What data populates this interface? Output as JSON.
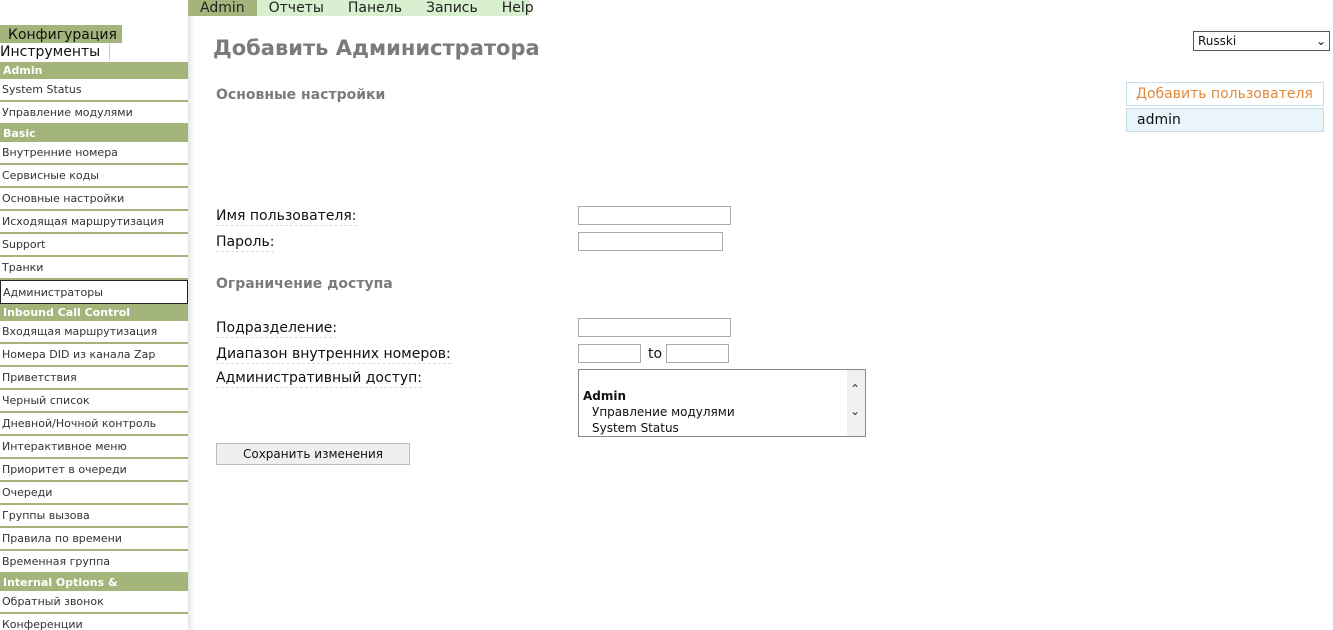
{
  "topmenu": {
    "items": [
      {
        "label": "Admin"
      },
      {
        "label": "Отчеты"
      },
      {
        "label": "Панель"
      },
      {
        "label": "Запись"
      },
      {
        "label": "Help"
      }
    ]
  },
  "sidebar": {
    "tab_config": "Конфигурация",
    "tab_tools": "Инструменты",
    "sections": [
      {
        "title": "Admin",
        "items": [
          "System Status",
          "Управление модулями"
        ]
      },
      {
        "title": "Basic",
        "items": [
          "Внутренние номера",
          "Сервисные коды",
          "Основные настройки",
          "Исходящая маршрутизация",
          "Support",
          "Транки",
          "Администраторы"
        ]
      },
      {
        "title": "Inbound Call Control",
        "items": [
          "Входящая маршрутизация",
          "Номера DID из канала Zap",
          "Приветствия",
          "Черный список",
          "Дневной/Ночной контроль",
          "Интерактивное меню",
          "Приоритет в очереди",
          "Очереди",
          "Группы вызова",
          "Правила по времени",
          "Временная группа"
        ]
      },
      {
        "title": "Internal Options & Configuration",
        "items": [
          "Обратный звонок",
          "Конференции"
        ]
      }
    ]
  },
  "main": {
    "title": "Добавить Администратора",
    "language": "Russki",
    "section_basic": "Основные настройки",
    "label_username": "Имя пользователя:",
    "label_password": "Пароль:",
    "section_access": "Ограничение доступа",
    "label_department": "Подразделение:",
    "label_ext_range": "Диапазон внутренних номеров:",
    "range_to": "to",
    "label_admin_access": "Административный доступ:",
    "access_group": "Admin",
    "access_options": [
      "Управление модулями",
      "System Status"
    ],
    "save_button": "Сохранить изменения"
  },
  "right_panel": {
    "add_user": "Добавить пользователя",
    "users": [
      "admin"
    ]
  },
  "colors": {
    "accent_green": "#a3b57a",
    "menu_bg": "#d8f0cf",
    "link_orange": "#e08a3c"
  }
}
